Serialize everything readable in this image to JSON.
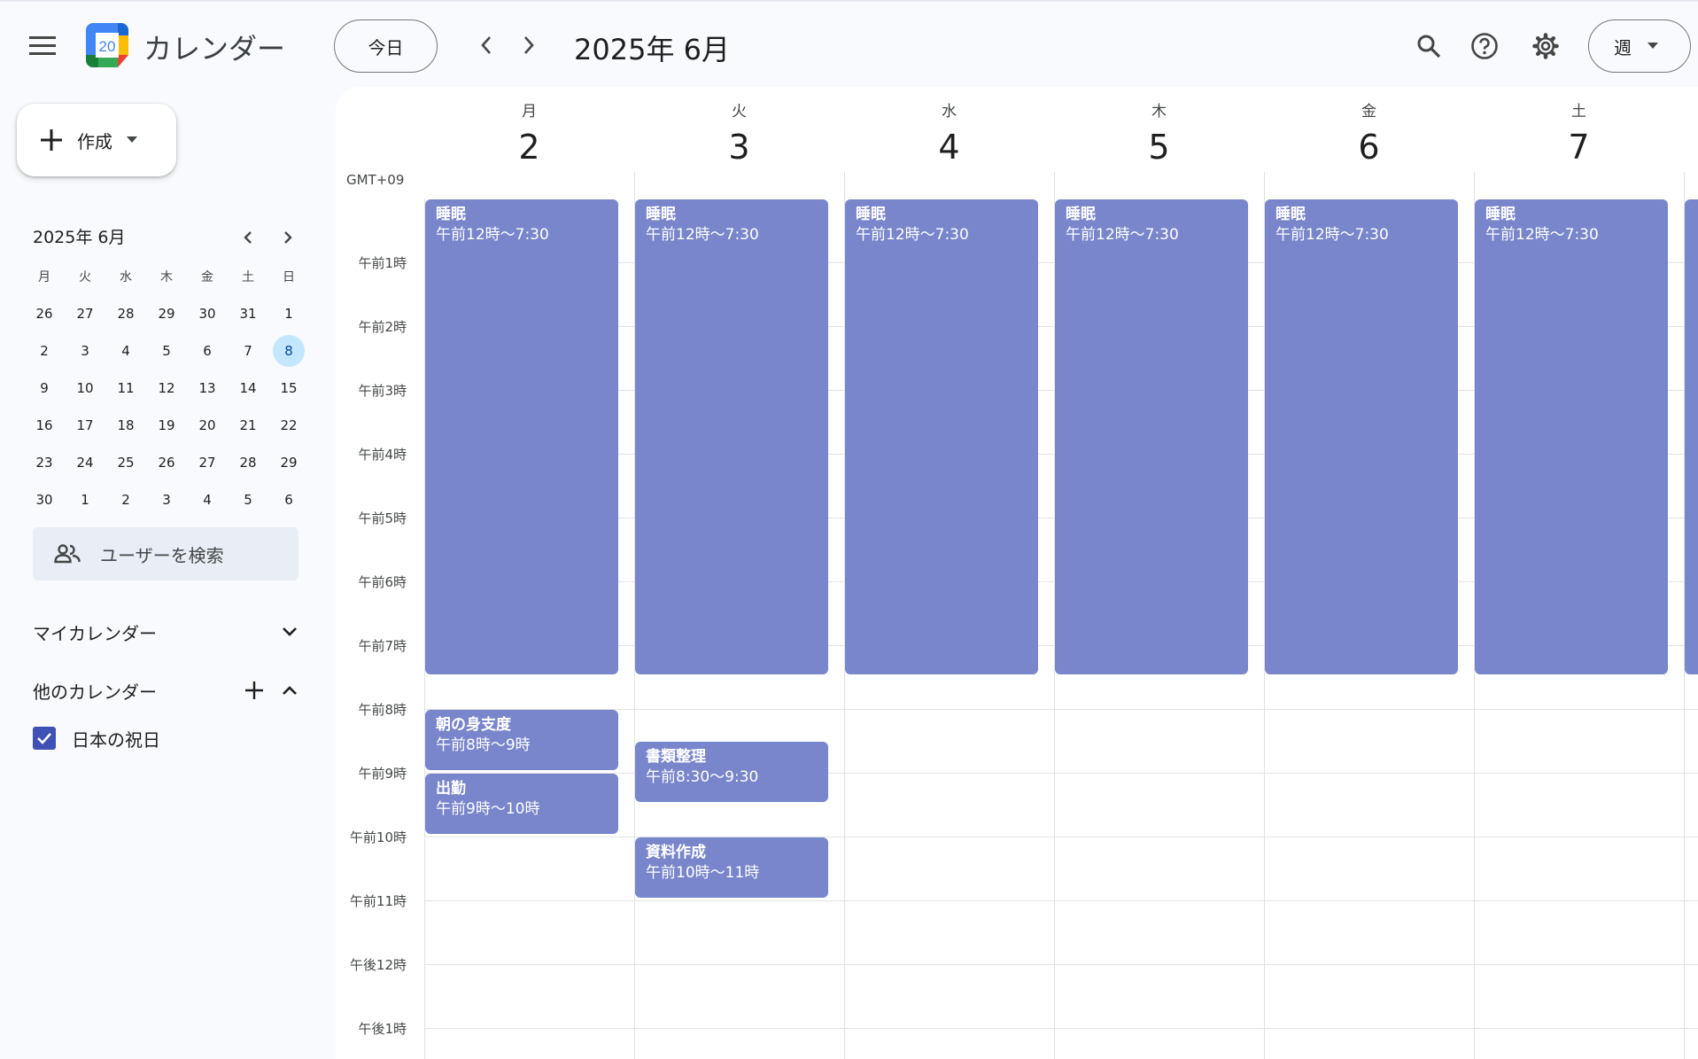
{
  "header": {
    "app_title": "カレンダー",
    "logo_day": "20",
    "today_label": "今日",
    "date_title": "2025年 6月",
    "view_label": "週",
    "icons": {
      "menu": "hamburger-menu-icon",
      "prev": "chevron-left-icon",
      "next": "chevron-right-icon",
      "search": "search-icon",
      "help": "help-icon",
      "settings": "gear-icon",
      "view_dropdown": "caret-down-icon"
    }
  },
  "sidebar": {
    "create_label": "作成",
    "mini_calendar": {
      "title": "2025年 6月",
      "weekdays": [
        "月",
        "火",
        "水",
        "木",
        "金",
        "土",
        "日"
      ],
      "days": [
        "26",
        "27",
        "28",
        "29",
        "30",
        "31",
        "1",
        "2",
        "3",
        "4",
        "5",
        "6",
        "7",
        "8",
        "9",
        "10",
        "11",
        "12",
        "13",
        "14",
        "15",
        "16",
        "17",
        "18",
        "19",
        "20",
        "21",
        "22",
        "23",
        "24",
        "25",
        "26",
        "27",
        "28",
        "29",
        "30",
        "1",
        "2",
        "3",
        "4",
        "5",
        "6"
      ],
      "selected_day": "8"
    },
    "people_search_placeholder": "ユーザーを検索",
    "my_calendars_label": "マイカレンダー",
    "other_calendars_label": "他のカレンダー",
    "other_calendars": [
      {
        "name": "日本の祝日",
        "checked": true,
        "color": "#3f51b5"
      }
    ]
  },
  "week": {
    "timezone": "GMT+09",
    "days": [
      {
        "dow": "月",
        "date": "2"
      },
      {
        "dow": "火",
        "date": "3"
      },
      {
        "dow": "水",
        "date": "4"
      },
      {
        "dow": "木",
        "date": "5"
      },
      {
        "dow": "金",
        "date": "6"
      },
      {
        "dow": "土",
        "date": "7"
      }
    ],
    "hours": [
      "午前1時",
      "午前2時",
      "午前3時",
      "午前4時",
      "午前5時",
      "午前6時",
      "午前7時",
      "午前8時",
      "午前9時",
      "午前10時",
      "午前11時",
      "午後12時",
      "午後1時"
    ],
    "event_color": "#7986cb",
    "events": [
      {
        "day": 0,
        "start": 0,
        "end": 7.5,
        "title": "睡眠",
        "time": "午前12時～7:30"
      },
      {
        "day": 1,
        "start": 0,
        "end": 7.5,
        "title": "睡眠",
        "time": "午前12時～7:30"
      },
      {
        "day": 2,
        "start": 0,
        "end": 7.5,
        "title": "睡眠",
        "time": "午前12時～7:30"
      },
      {
        "day": 3,
        "start": 0,
        "end": 7.5,
        "title": "睡眠",
        "time": "午前12時～7:30"
      },
      {
        "day": 4,
        "start": 0,
        "end": 7.5,
        "title": "睡眠",
        "time": "午前12時～7:30"
      },
      {
        "day": 5,
        "start": 0,
        "end": 7.5,
        "title": "睡眠",
        "time": "午前12時～7:30"
      },
      {
        "day": 6,
        "start": 0,
        "end": 7.5,
        "title": "",
        "time": ""
      },
      {
        "day": 0,
        "start": 8,
        "end": 9,
        "title": "朝の身支度",
        "time": "午前8時～9時"
      },
      {
        "day": 0,
        "start": 9,
        "end": 10,
        "title": "出勤",
        "time": "午前9時～10時"
      },
      {
        "day": 1,
        "start": 8.5,
        "end": 9.5,
        "title": "書類整理",
        "time": "午前8:30～9:30"
      },
      {
        "day": 1,
        "start": 10,
        "end": 11,
        "title": "資料作成",
        "time": "午前10時～11時"
      }
    ]
  }
}
